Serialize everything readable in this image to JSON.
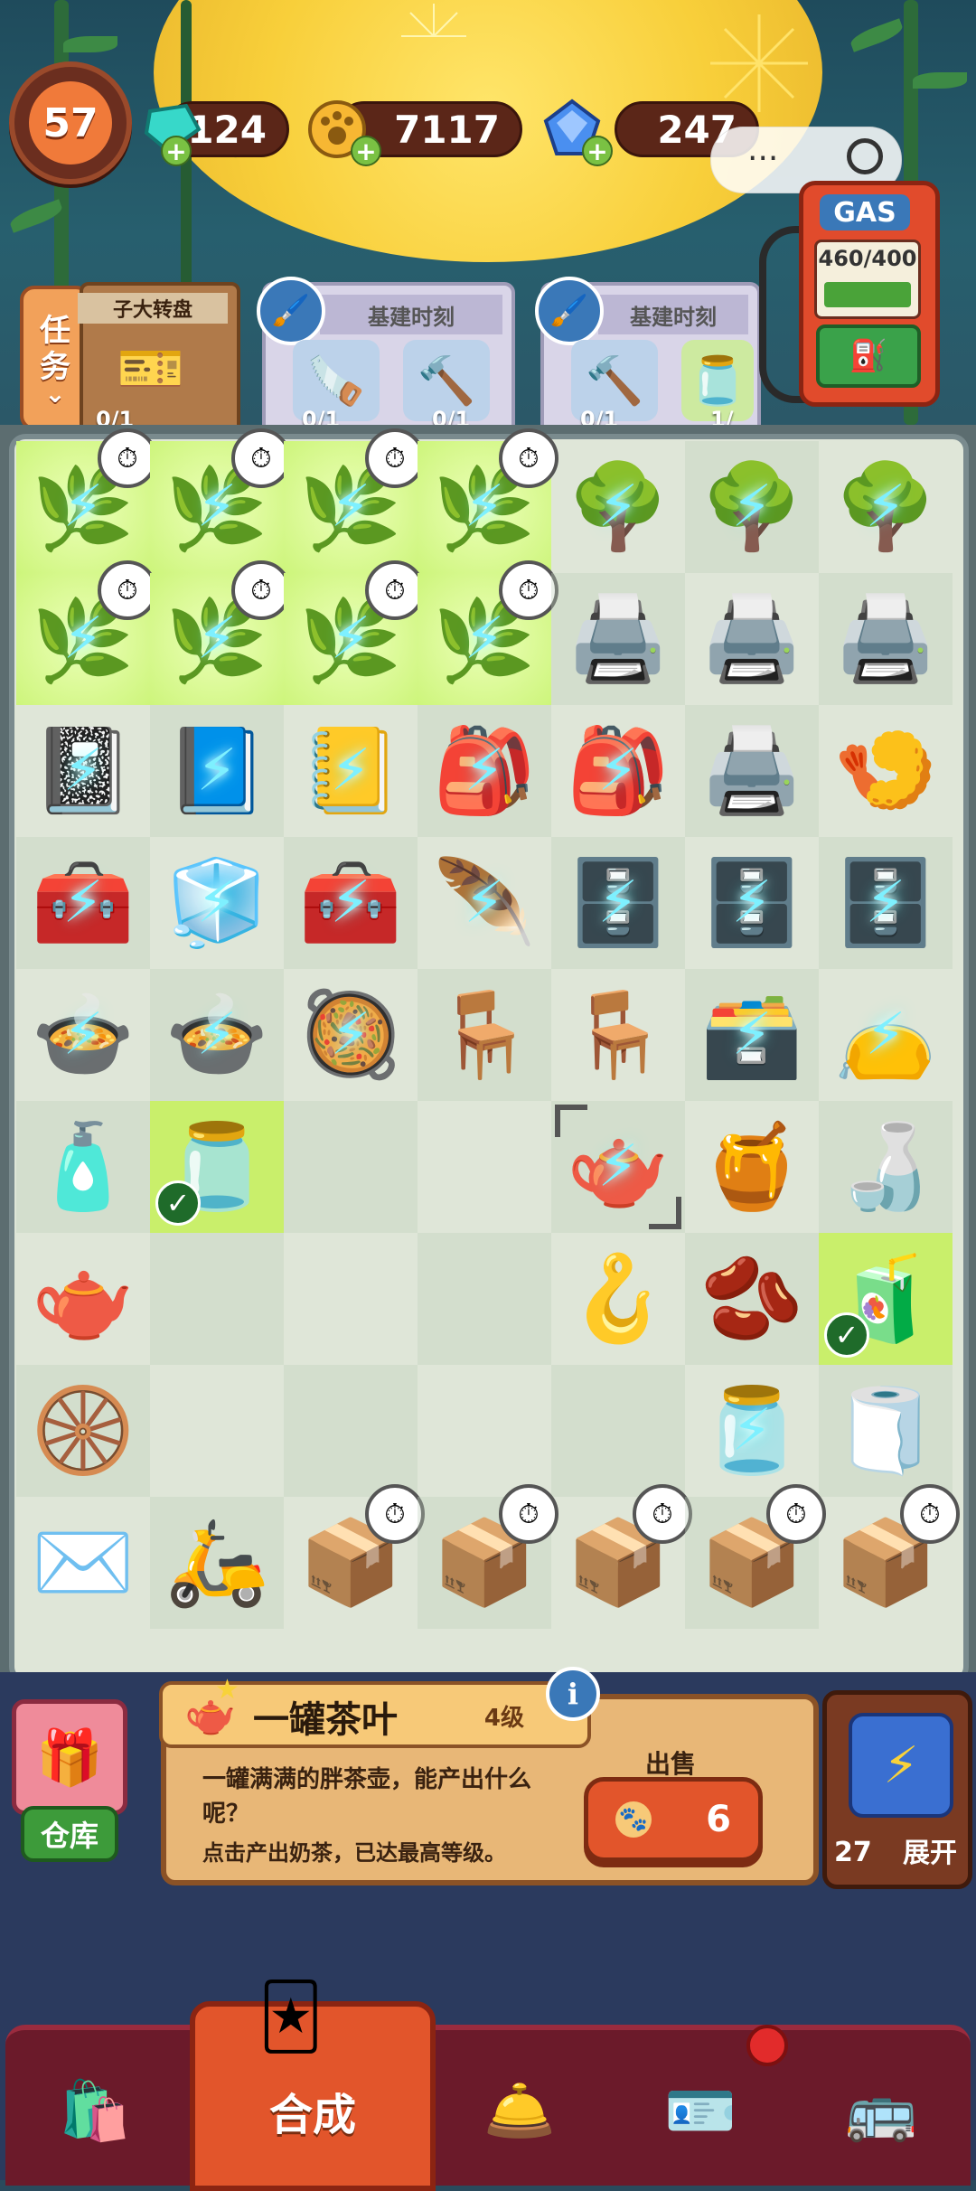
{
  "hud": {
    "level": "57",
    "currencies": [
      {
        "icon": "energy-crystal-icon",
        "value": "124"
      },
      {
        "icon": "paw-coin-icon",
        "value": "7117"
      },
      {
        "icon": "diamond-gem-icon",
        "value": "247"
      }
    ]
  },
  "task_button": {
    "label_top": "任",
    "label_bottom": "务",
    "chevron": "⌄"
  },
  "quests": [
    {
      "title": "子大转盘",
      "progress": "0/1"
    },
    {
      "title": "基建时刻",
      "slots": [
        {
          "icon": "saw-icon",
          "progress": "0/1"
        },
        {
          "icon": "hammer-icon",
          "progress": "0/1"
        }
      ]
    },
    {
      "title": "基建时刻",
      "slots": [
        {
          "icon": "mallet-icon",
          "progress": "0/1"
        },
        {
          "icon": "jar-icon",
          "progress": "1/"
        }
      ]
    }
  ],
  "gas_pump": {
    "label": "GAS",
    "count": "460/400"
  },
  "board": {
    "rows": [
      [
        {
          "e": "🌿",
          "bolt": true,
          "timer": true,
          "glow": true
        },
        {
          "e": "🌿",
          "bolt": true,
          "timer": true,
          "glow": true
        },
        {
          "e": "🌿",
          "bolt": true,
          "timer": true,
          "glow": true
        },
        {
          "e": "🌿",
          "bolt": true,
          "timer": true,
          "glow": true
        },
        {
          "e": "🌳",
          "bolt": true
        },
        {
          "e": "🌳",
          "bolt": true
        },
        {
          "e": "🌳",
          "bolt": true
        }
      ],
      [
        {
          "e": "🌿",
          "bolt": true,
          "timer": true,
          "glow": true
        },
        {
          "e": "🌿",
          "bolt": true,
          "timer": true,
          "glow": true
        },
        {
          "e": "🌿",
          "bolt": true,
          "timer": true,
          "glow": true
        },
        {
          "e": "🌿",
          "bolt": true,
          "timer": true,
          "glow": true
        },
        {
          "e": "🖨️"
        },
        {
          "e": "🖨️"
        },
        {
          "e": "🖨️"
        }
      ],
      [
        {
          "e": "📓",
          "bolt": true
        },
        {
          "e": "📘",
          "bolt": true
        },
        {
          "e": "📒",
          "bolt": true
        },
        {
          "e": "🎒",
          "bolt": true
        },
        {
          "e": "🎒",
          "bolt": true
        },
        {
          "e": "🖨️"
        },
        {
          "e": "🍤"
        }
      ],
      [
        {
          "e": "🧰",
          "bolt": true
        },
        {
          "e": "🧊",
          "bolt": true
        },
        {
          "e": "🧰",
          "bolt": true
        },
        {
          "e": "🪶",
          "bolt": true
        },
        {
          "e": "🗄️",
          "bolt": true
        },
        {
          "e": "🗄️",
          "bolt": true
        },
        {
          "e": "🗄️",
          "bolt": true
        }
      ],
      [
        {
          "e": "🍲",
          "bolt": true
        },
        {
          "e": "🍲",
          "bolt": true
        },
        {
          "e": "🥘",
          "bolt": true
        },
        {
          "e": "🪑"
        },
        {
          "e": "🪑"
        },
        {
          "e": "🗃️",
          "bolt": true
        },
        {
          "e": "👝",
          "bolt": true
        }
      ],
      [
        {
          "e": "🧴"
        },
        {
          "e": "🫙",
          "check": true,
          "lime": true
        },
        {
          "e": ""
        },
        {
          "e": ""
        },
        {
          "e": "🫖",
          "bolt": true,
          "select": true
        },
        {
          "e": "🍯"
        },
        {
          "e": "🍶"
        }
      ],
      [
        {
          "e": "🫖"
        },
        {
          "e": ""
        },
        {
          "e": ""
        },
        {
          "e": ""
        },
        {
          "e": "🪝"
        },
        {
          "e": "🫘"
        },
        {
          "e": "🧃",
          "check": true,
          "lime": true
        }
      ],
      [
        {
          "e": "🛞"
        },
        {
          "e": ""
        },
        {
          "e": ""
        },
        {
          "e": ""
        },
        {
          "e": ""
        },
        {
          "e": "🫙",
          "bolt": true
        },
        {
          "e": "🧻"
        }
      ],
      [
        {
          "e": "✉️"
        },
        {
          "e": "🛵"
        },
        {
          "e": "📦",
          "timer": true
        },
        {
          "e": "📦",
          "timer": true
        },
        {
          "e": "📦",
          "timer": true
        },
        {
          "e": "📦",
          "timer": true
        },
        {
          "e": "📦",
          "timer": true
        }
      ]
    ]
  },
  "warehouse": {
    "label": "仓库"
  },
  "item_info": {
    "name": "一罐茶叶",
    "level": "4级",
    "description": "一罐满满的胖茶壶，能产出什么呢？",
    "hint": "点击产出奶茶，已达最高等级。",
    "sell_label": "出售",
    "sell_price": "6"
  },
  "expand": {
    "count": "27",
    "label": "展开"
  },
  "nav": {
    "active_label": "合成",
    "items": [
      "shop-bag-icon",
      "merge-icon",
      "service-bell-icon",
      "profile-card-icon",
      "bus-icon"
    ]
  }
}
